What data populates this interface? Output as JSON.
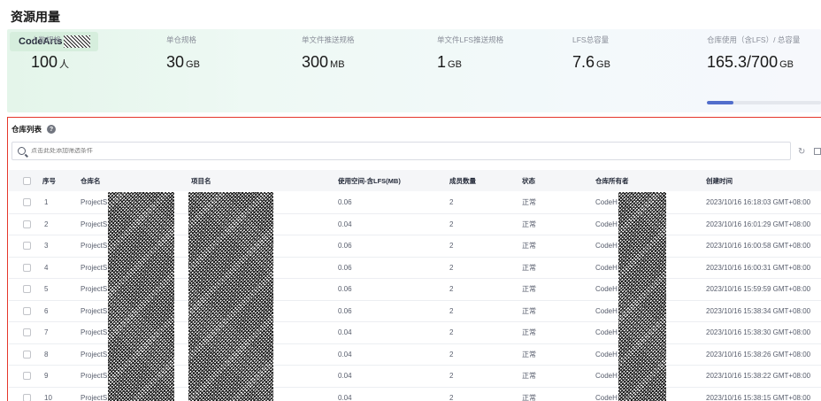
{
  "page": {
    "title": "资源用量"
  },
  "tenant": {
    "tag": "CodeArts"
  },
  "stats": [
    {
      "label": "人数规格",
      "value": "100",
      "unit": "人"
    },
    {
      "label": "单仓规格",
      "value": "30",
      "unit": "GB"
    },
    {
      "label": "单文件推送规格",
      "value": "300",
      "unit": "MB"
    },
    {
      "label": "单文件LFS推送规格",
      "value": "1",
      "unit": "GB"
    },
    {
      "label": "LFS总容量",
      "value": "7.6",
      "unit": "GB"
    },
    {
      "label": "仓库使用（含LFS）/ 总容量",
      "value": "165.3/700",
      "unit": "GB"
    }
  ],
  "usage_progress": {
    "used": 165.3,
    "total": 700,
    "fraction": 0.236,
    "color": "#526ecc"
  },
  "list": {
    "title": "仓库列表",
    "help_icon": "help-icon",
    "search_placeholder": "点击此处添加筛选条件",
    "columns": [
      "序号",
      "仓库名",
      "项目名",
      "使用空间-含LFS(MB)",
      "成员数量",
      "状态",
      "仓库所有者",
      "创建时间"
    ],
    "rows": [
      {
        "no": "1",
        "repo": "ProjectS",
        "usage": "0.06",
        "members": "2",
        "status": "正常",
        "owner": "CodeH",
        "created": "2023/10/16 16:18:03 GMT+08:00"
      },
      {
        "no": "2",
        "repo": "ProjectS",
        "usage": "0.04",
        "members": "2",
        "status": "正常",
        "owner": "CodeH",
        "created": "2023/10/16 16:01:29 GMT+08:00"
      },
      {
        "no": "3",
        "repo": "ProjectS",
        "usage": "0.06",
        "members": "2",
        "status": "正常",
        "owner": "CodeH",
        "created": "2023/10/16 16:00:58 GMT+08:00"
      },
      {
        "no": "4",
        "repo": "ProjectS",
        "usage": "0.06",
        "members": "2",
        "status": "正常",
        "owner": "CodeH",
        "created": "2023/10/16 16:00:31 GMT+08:00"
      },
      {
        "no": "5",
        "repo": "ProjectS",
        "usage": "0.06",
        "members": "2",
        "status": "正常",
        "owner": "CodeH",
        "created": "2023/10/16 15:59:59 GMT+08:00"
      },
      {
        "no": "6",
        "repo": "ProjectS",
        "usage": "0.06",
        "members": "2",
        "status": "正常",
        "owner": "CodeH",
        "created": "2023/10/16 15:38:34 GMT+08:00"
      },
      {
        "no": "7",
        "repo": "ProjectS",
        "usage": "0.04",
        "members": "2",
        "status": "正常",
        "owner": "CodeH",
        "created": "2023/10/16 15:38:30 GMT+08:00"
      },
      {
        "no": "8",
        "repo": "ProjectS",
        "usage": "0.04",
        "members": "2",
        "status": "正常",
        "owner": "CodeH",
        "created": "2023/10/16 15:38:26 GMT+08:00"
      },
      {
        "no": "9",
        "repo": "ProjectS",
        "usage": "0.04",
        "members": "2",
        "status": "正常",
        "owner": "CodeH",
        "created": "2023/10/16 15:38:22 GMT+08:00"
      },
      {
        "no": "10",
        "repo": "ProjectS",
        "usage": "0.04",
        "members": "2",
        "status": "正常",
        "owner": "CodeH",
        "created": "2023/10/16 15:38:15 GMT+08:00"
      }
    ]
  },
  "colors": {
    "highlight_border": "#e5372b",
    "panel_bg": "#e4f5ea",
    "accent": "#526ecc"
  }
}
